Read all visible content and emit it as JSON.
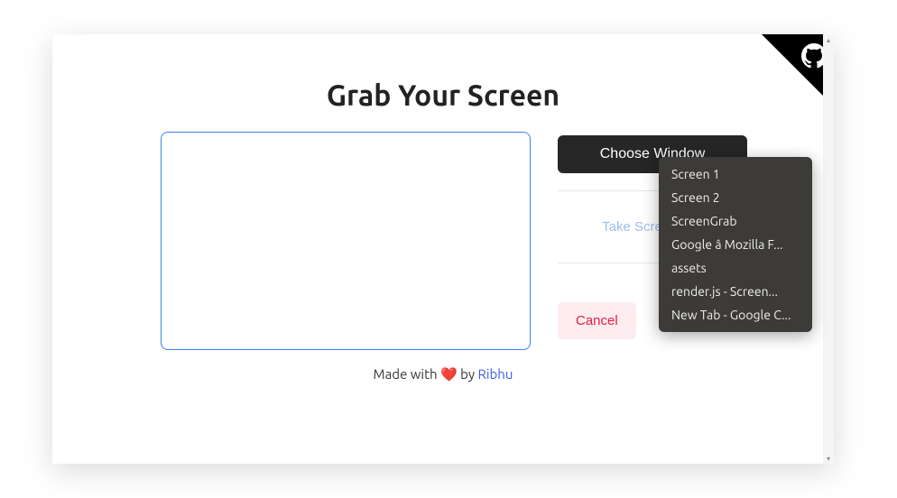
{
  "title": "Grab Your Screen",
  "buttons": {
    "choose": "Choose Window",
    "screenshot": "Take Screenshot",
    "cancel": "Cancel"
  },
  "footer": {
    "prefix": "Made with ",
    "heart": "❤️",
    "by": " by ",
    "author": "Ribhu"
  },
  "context_menu": {
    "items": [
      "Screen 1",
      "Screen 2",
      "ScreenGrab",
      "Google â Mozilla F...",
      "assets",
      "render.js - Screen...",
      "New Tab - Google C..."
    ]
  }
}
